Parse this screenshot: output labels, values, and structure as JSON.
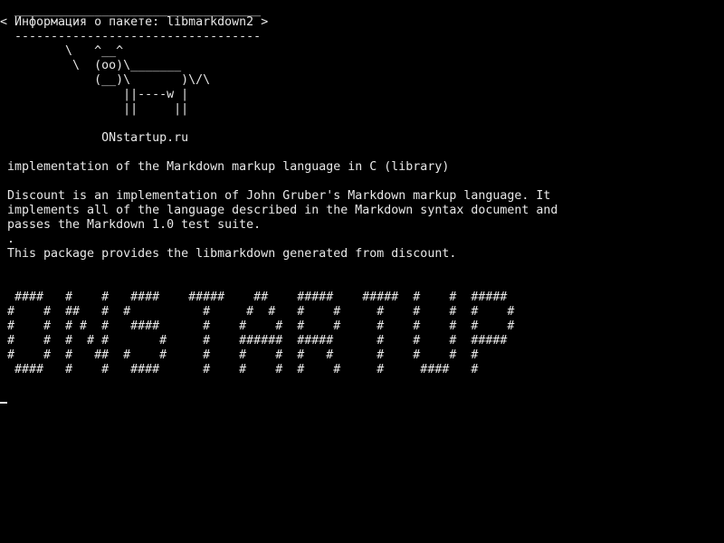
{
  "colors": {
    "background": "#000000",
    "foreground": "#e8e8e8"
  },
  "cowsay": {
    "border_top": " __________________________________",
    "message": "< Информация о пакете: libmarkdown2 >",
    "border_bottom": " ----------------------------------",
    "cow": [
      "        \\   ^__^",
      "         \\  (oo)\\_______",
      "            (__)\\       )\\/\\",
      "                ||----w |",
      "                ||     ||"
    ],
    "site": "             ONstartup.ru"
  },
  "package": {
    "summary": "implementation of the Markdown markup language in C (library)",
    "description": [
      "Discount is an implementation of John Gruber's Markdown markup language. It",
      "implements all of the language described in the Markdown syntax document and",
      "passes the Markdown 1.0 test suite.",
      ".",
      "This package provides the libmarkdown generated from discount."
    ]
  },
  "banner": [
    " ####   #    #   ####    #####    ##    #####    #####  #    #  #####",
    "#    #  ##   #  #          #     #  #   #    #     #    #    #  #    #",
    "#    #  # #  #   ####      #    #    #  #    #     #    #    #  #    #",
    "#    #  #  # #       #     #    ######  #####      #    #    #  #####",
    "#    #  #   ##  #    #     #    #    #  #   #      #    #    #  #",
    " ####   #    #   ####      #    #    #  #    #     #     ####   #"
  ]
}
